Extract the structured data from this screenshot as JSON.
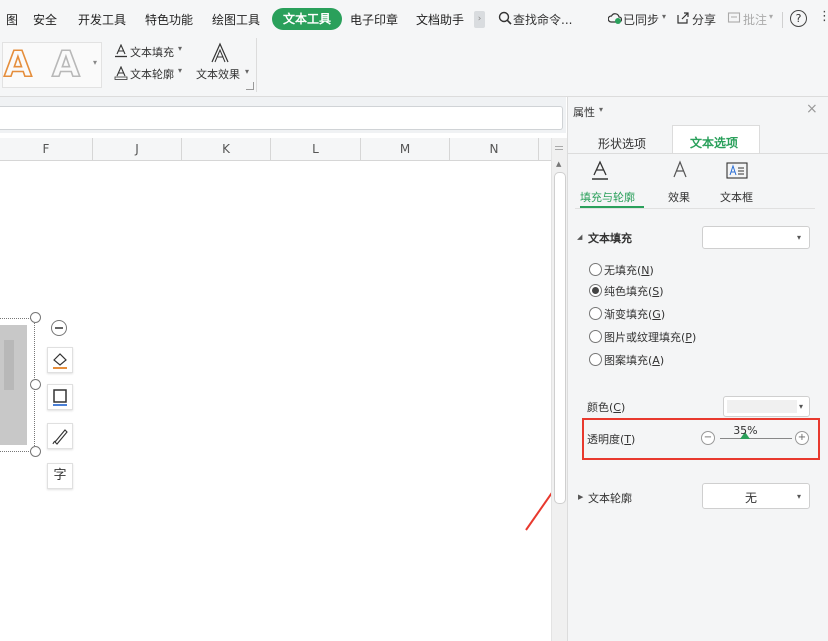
{
  "menubar": {
    "items": [
      "图",
      "安全",
      "开发工具",
      "特色功能",
      "绘图工具",
      "电子印章",
      "文档助手"
    ],
    "active_tab": "文本工具",
    "search_label": "查找命令...",
    "sync_label": "已同步",
    "share_label": "分享",
    "comment_label": "批注",
    "help_symbol": "?"
  },
  "ribbon": {
    "style_letter": "A",
    "text_fill": "文本填充",
    "text_outline": "文本轮廓",
    "text_effects": "文本效果",
    "dropdown_mark": "▾"
  },
  "columns": [
    "F",
    "J",
    "K",
    "L",
    "M",
    "N"
  ],
  "shape_tools": {
    "text_icon": "字"
  },
  "panel": {
    "title": "属性",
    "tabs": [
      "形状选项",
      "文本选项"
    ],
    "active_tab_index": 1,
    "subtabs": [
      "填充与轮廓",
      "效果",
      "文本框"
    ],
    "active_subtab_index": 0,
    "text_fill_section": "文本填充",
    "fill_options": [
      {
        "label": "无填充",
        "key": "N",
        "checked": false
      },
      {
        "label": "纯色填充",
        "key": "S",
        "checked": true
      },
      {
        "label": "渐变填充",
        "key": "G",
        "checked": false
      },
      {
        "label": "图片或纹理填充",
        "key": "P",
        "checked": false
      },
      {
        "label": "图案填充",
        "key": "A",
        "checked": false
      }
    ],
    "color_label": "颜色",
    "color_key": "C",
    "transparency_label": "透明度",
    "transparency_key": "T",
    "transparency_value": "35%",
    "transparency_fraction": 0.35,
    "minus_symbol": "−",
    "plus_symbol": "+",
    "outline_section": "文本轮廓",
    "outline_value": "无"
  },
  "colors": {
    "accent_green": "#2aa05b",
    "highlight_red": "#e8392e",
    "style_orange": "#e58e3c"
  }
}
